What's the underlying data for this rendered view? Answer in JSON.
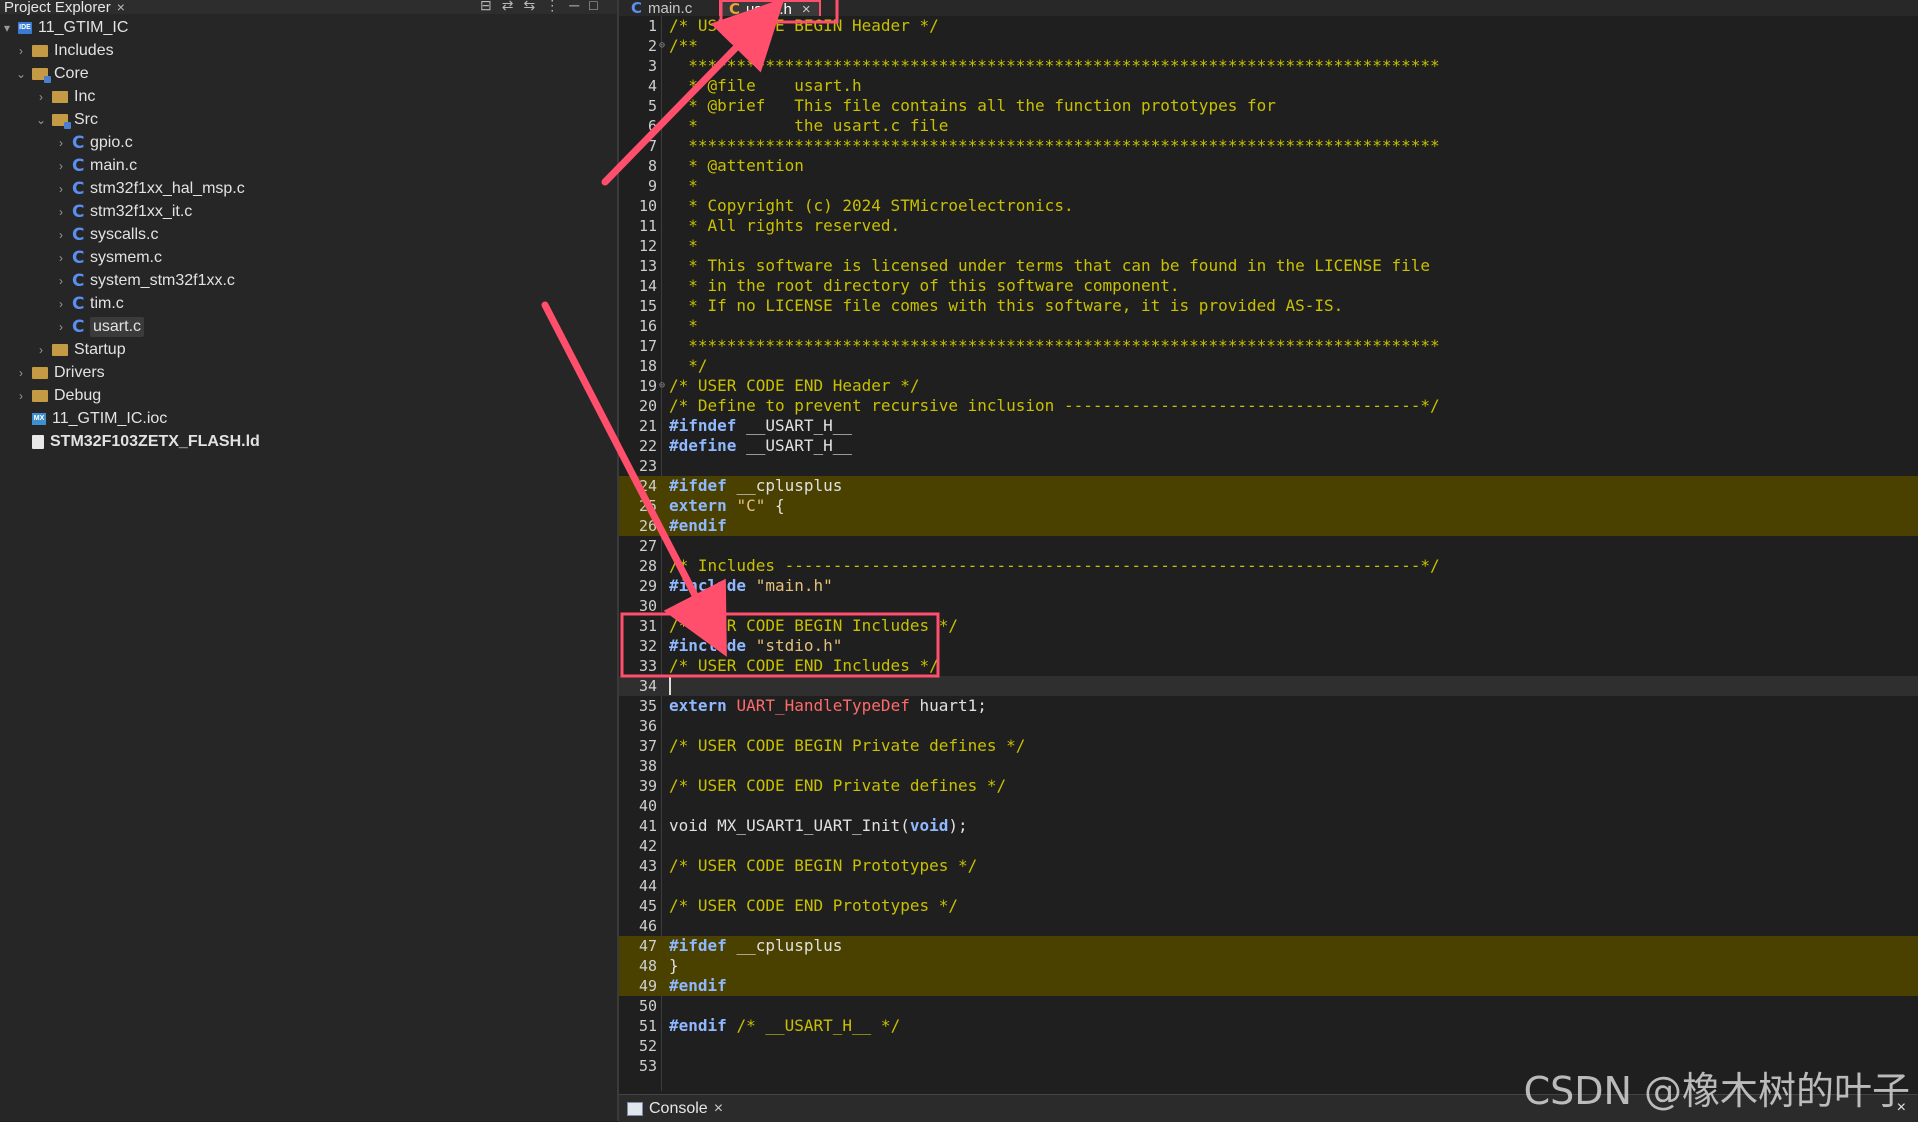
{
  "explorer": {
    "title": "Project Explorer",
    "close": "×",
    "tools": [
      "⊟",
      "⇄",
      "⇆",
      "⋮",
      "─",
      "□"
    ],
    "project": "11_GTIM_IC",
    "includes": "Includes",
    "core": "Core",
    "inc": "Inc",
    "src": "Src",
    "files": [
      "gpio.c",
      "main.c",
      "stm32f1xx_hal_msp.c",
      "stm32f1xx_it.c",
      "syscalls.c",
      "sysmem.c",
      "system_stm32f1xx.c",
      "tim.c",
      "usart.c"
    ],
    "startup": "Startup",
    "drivers": "Drivers",
    "debug": "Debug",
    "ioc": "11_GTIM_IC.ioc",
    "ld": "STM32F103ZETX_FLASH.ld",
    "c_glyph": "C",
    "ide_glyph": "IDE",
    "mx_glyph": "MX"
  },
  "tabs": {
    "main": "main.c",
    "usart": "usart.h",
    "close": "×"
  },
  "code_lines": [
    "/* USER CODE BEGIN Header */",
    "/**",
    "  ******************************************************************************",
    "  * @file    usart.h",
    "  * @brief   This file contains all the function prototypes for",
    "  *          the usart.c file",
    "  ******************************************************************************",
    "  * @attention",
    "  *",
    "  * Copyright (c) 2024 STMicroelectronics.",
    "  * All rights reserved.",
    "  *",
    "  * This software is licensed under terms that can be found in the LICENSE file",
    "  * in the root directory of this software component.",
    "  * If no LICENSE file comes with this software, it is provided AS-IS.",
    "  *",
    "  ******************************************************************************",
    "  */",
    "/* USER CODE END Header */",
    "/* Define to prevent recursive inclusion -------------------------------------*/",
    "#ifndef __USART_H__",
    "#define __USART_H__",
    "",
    "#ifdef __cplusplus",
    "extern \"C\" {",
    "#endif",
    "",
    "/* Includes ------------------------------------------------------------------*/",
    "#include \"main.h\"",
    "",
    "/* USER CODE BEGIN Includes */",
    "#include \"stdio.h\"",
    "/* USER CODE END Includes */",
    "",
    "extern UART_HandleTypeDef huart1;",
    "",
    "/* USER CODE BEGIN Private defines */",
    "",
    "/* USER CODE END Private defines */",
    "",
    "void MX_USART1_UART_Init(void);",
    "",
    "/* USER CODE BEGIN Prototypes */",
    "",
    "/* USER CODE END Prototypes */",
    "",
    "#ifdef __cplusplus",
    "}",
    "#endif",
    "",
    "#endif /* __USART_H__ */",
    "",
    ""
  ],
  "highlighted_lines": [
    24,
    25,
    26,
    47,
    48,
    49
  ],
  "cursor_line": 34,
  "fold_lines": [
    2,
    19
  ],
  "console": {
    "label": "Console",
    "close": "×"
  },
  "watermark": "CSDN @橡木树的叶子",
  "colors": {
    "accent": "#ff4f6d",
    "highlight": "#4a4100",
    "comment": "#c8c000",
    "keyword": "#8fb8ff"
  }
}
